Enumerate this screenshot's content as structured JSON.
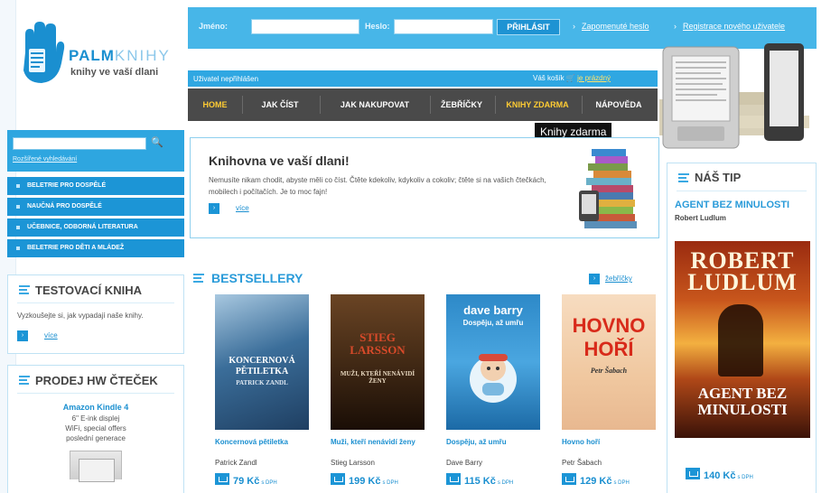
{
  "logo": {
    "name_bold": "PALM",
    "name_thin": "KNIHY",
    "tagline": "knihy ve vaší dlani"
  },
  "login": {
    "name_label": "Jméno:",
    "password_label": "Heslo:",
    "submit": "PŘIHLÁSIT",
    "forgot_link": "Zapomenuté heslo",
    "register_link": "Registrace nového uživatele"
  },
  "userbar": {
    "status": "Uživatel nepřihlášen",
    "cart_label": "Váš košík",
    "cart_value": "je prázdný"
  },
  "nav": {
    "items": [
      "HOME",
      "JAK ČÍST",
      "JAK NAKUPOVAT",
      "ŽEBŘÍČKY",
      "KNIHY ZDARMA",
      "NÁPOVĚDA"
    ]
  },
  "tooltip": "Knihy zdarma",
  "search": {
    "placeholder": "",
    "advanced_link": "Rozšířené vyhledávání"
  },
  "categories": [
    "BELETRIE PRO DOSPĚLÉ",
    "NAUČNÁ PRO DOSPĚLÉ",
    "UČEBNICE, ODBORNÁ LITERATURA",
    "BELETRIE PRO DĚTI A MLÁDEŽ"
  ],
  "test_book": {
    "title": "TESTOVACÍ KNIHA",
    "text": "Vyzkoušejte si, jak vypadají naše knihy.",
    "more": "více"
  },
  "hw": {
    "title": "PRODEJ HW ČTEČEK",
    "device_name": "Amazon Kindle 4",
    "desc_lines": [
      "6\" E-ink displej",
      "WiFi, special offers",
      "poslední generace"
    ]
  },
  "intro": {
    "title": "Knihovna ve vaší dlani!",
    "text": "Nemusíte nikam chodit, abyste měli co číst. Čtěte kdekoliv, kdykoliv a cokoliv; čtěte si na vašich čtečkách, mobilech i počítačích. Je to moc fajn!",
    "more": "více"
  },
  "bestsellers": {
    "title": "BESTSELLERY",
    "charts_link": "žebříčky",
    "vat_label": "s DPH",
    "books": [
      {
        "title": "Koncernová pětiletka",
        "author": "Patrick Zandl",
        "price": "79 Kč",
        "cover_lines": [
          "KONCERNOVÁ",
          "PĚTILETKA",
          "PATRICK ZANDL"
        ],
        "cover_color": "#3b6e9a"
      },
      {
        "title": "Muži, kteří nenávidí ženy",
        "author": "Stieg Larsson",
        "price": "199 Kč",
        "cover_lines": [
          "STIEG",
          "LARSSON",
          "MUŽI, KTEŘÍ NENÁVIDÍ ŽENY"
        ],
        "cover_color": "#5a3a1e"
      },
      {
        "title": "Dospěju, až umřu",
        "author": "Dave Barry",
        "price": "115 Kč",
        "cover_lines": [
          "dave barry",
          "Dospěju, až umřu"
        ],
        "cover_color": "#2d89c8"
      },
      {
        "title": "Hovno hoří",
        "author": "Petr Šabach",
        "price": "129 Kč",
        "cover_lines": [
          "HOVNO",
          "HOŘÍ",
          "Petr Šabach"
        ],
        "cover_color": "#f0c8a0"
      }
    ]
  },
  "tip": {
    "title": "NÁŠ TIP",
    "book_title": "AGENT BEZ MINULOSTI",
    "author": "Robert Ludlum",
    "cover_top": "ROBERT LUDLUM",
    "cover_bottom": "AGENT BEZ MINULOSTI",
    "price": "140 Kč",
    "vat_label": "s DPH"
  },
  "colors": {
    "accent": "#2a9bd9",
    "nav_bg": "#4a4a4a",
    "nav_highlight": "#ffcc33",
    "header_blue": "#47b6e8"
  }
}
